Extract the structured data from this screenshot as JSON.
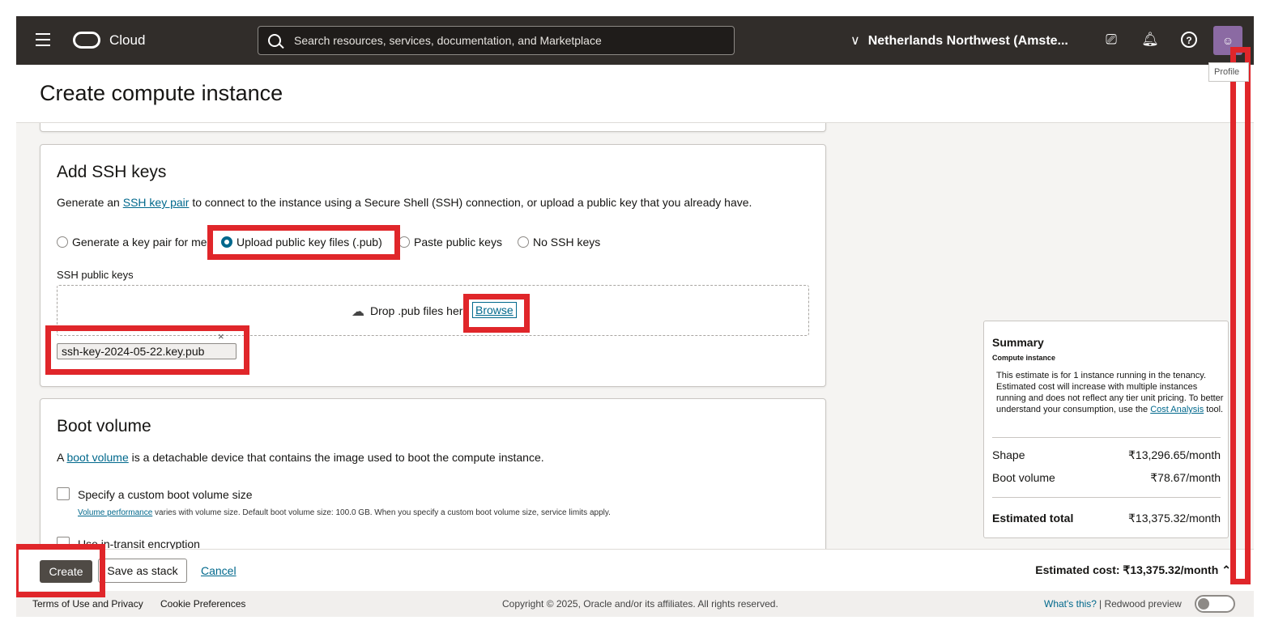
{
  "topbar": {
    "brand": "Cloud",
    "search_placeholder": "Search resources, services, documentation, and Marketplace",
    "region": "Netherlands Northwest (Amste...",
    "tooltip": "Profile"
  },
  "page": {
    "title": "Create compute instance"
  },
  "ssh": {
    "heading": "Add SSH keys",
    "desc_pre": "Generate an ",
    "desc_link": "SSH key pair",
    "desc_post": " to connect to the instance using a Secure Shell (SSH) connection, or upload a public key that you already have.",
    "options": [
      {
        "label": "Generate a key pair for me",
        "selected": false
      },
      {
        "label": "Upload public key files (.pub)",
        "selected": true
      },
      {
        "label": "Paste public keys",
        "selected": false
      },
      {
        "label": "No SSH keys",
        "selected": false
      }
    ],
    "field_label": "SSH public keys",
    "drop_text": "Drop .pub files here",
    "browse_label": "Browse",
    "file_name": "ssh-key-2024-05-22.key.pub",
    "remove_glyph": "×"
  },
  "boot": {
    "heading": "Boot volume",
    "desc_pre": "A ",
    "desc_link": "boot volume",
    "desc_post": " is a detachable device that contains the image used to boot the compute instance.",
    "custom_size_label": "Specify a custom boot volume size",
    "help_link": "Volume performance",
    "help_text": " varies with volume size. Default boot volume size: 100.0 GB. When you specify a custom boot volume size, service limits apply.",
    "encryption_label": "Use in-transit encryption"
  },
  "summary": {
    "title": "Summary",
    "subtitle": "Compute instance",
    "note_pre": "This estimate is for 1 instance running in the tenancy. Estimated cost will increase with multiple instances running and does not reflect any tier unit pricing. To better understand your consumption, use the ",
    "note_link": "Cost Analysis",
    "note_post": " tool.",
    "shape_label": "Shape",
    "shape_value": "₹13,296.65/month",
    "boot_label": "Boot volume",
    "boot_value": "₹78.67/month",
    "total_label": "Estimated total",
    "total_value": "₹13,375.32/month"
  },
  "actions": {
    "create": "Create",
    "save_stack": "Save as stack",
    "cancel": "Cancel",
    "estimated_cost": "Estimated cost: ₹13,375.32/month"
  },
  "footer": {
    "terms": "Terms of Use and Privacy",
    "cookies": "Cookie Preferences",
    "copyright": "Copyright © 2025, Oracle and/or its affiliates. All rights reserved.",
    "whats_this": "What's this?",
    "redwood": "| Redwood preview",
    "redwood_enabled": false
  },
  "colors": {
    "annotation": "#e0262a",
    "link": "#00688c",
    "topbar": "#312d2a"
  },
  "icons": [
    "hamburger-icon",
    "oracle-logo-icon",
    "search-icon",
    "chevron-down-icon",
    "cloud-shell-icon",
    "bell-icon",
    "help-icon",
    "user-icon",
    "upload-cloud-icon",
    "close-icon",
    "chevron-up-icon"
  ]
}
